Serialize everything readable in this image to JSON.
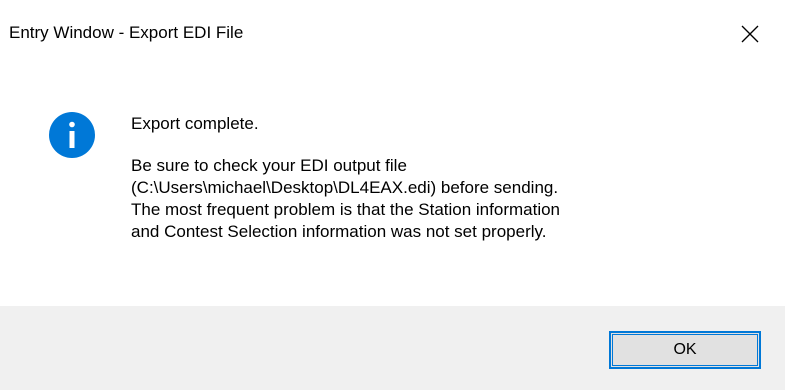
{
  "window": {
    "title": "Entry Window - Export EDI File"
  },
  "icons": {
    "close": "close-icon",
    "info": "info-icon"
  },
  "message": {
    "heading": "Export complete.",
    "lines": [
      "Be sure to check your EDI output file",
      "(C:\\Users\\michael\\Desktop\\DL4EAX.edi) before sending.",
      "The most frequent problem is that the Station information",
      "and Contest Selection information was not set properly."
    ]
  },
  "buttons": {
    "ok_label": "OK"
  },
  "colors": {
    "info_icon": "#0078d7",
    "focus_border": "#0078d7",
    "button_face": "#e1e1e1",
    "footer_bg": "#f0f0f0"
  }
}
